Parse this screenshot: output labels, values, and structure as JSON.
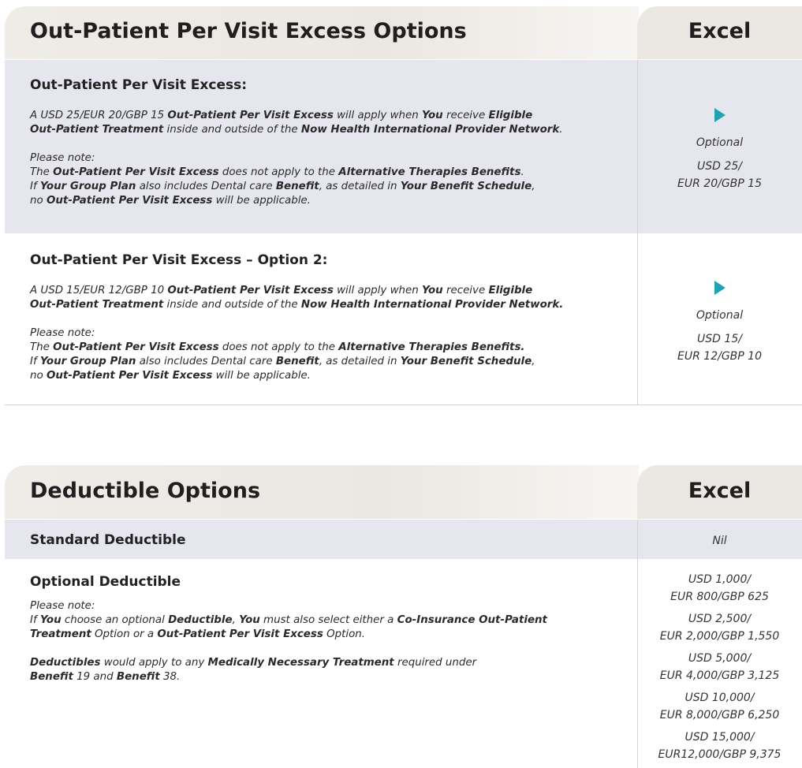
{
  "section1": {
    "title": "Out-Patient Per Visit Excess Options",
    "plan": "Excel",
    "row1": {
      "heading": "Out-Patient Per Visit Excess:",
      "p1": [
        {
          "t": "A USD 25/EUR 20/GBP 15 "
        },
        {
          "t": "Out-Patient Per Visit Excess",
          "b": true
        },
        {
          "t": " will apply when "
        },
        {
          "t": "You",
          "b": true
        },
        {
          "t": " receive "
        },
        {
          "t": "Eligible",
          "b": true
        },
        {
          "br": true
        },
        {
          "t": "Out-Patient Treatment",
          "b": true
        },
        {
          "t": " inside and outside of the "
        },
        {
          "t": "Now Health International Provider Network",
          "b": true
        },
        {
          "t": "."
        }
      ],
      "p2": [
        {
          "t": "Please note:"
        },
        {
          "br": true
        },
        {
          "t": "The "
        },
        {
          "t": "Out-Patient Per Visit Excess",
          "b": true
        },
        {
          "t": " does not apply to the "
        },
        {
          "t": "Alternative Therapies Benefits",
          "b": true
        },
        {
          "t": "."
        },
        {
          "br": true
        },
        {
          "t": "If "
        },
        {
          "t": "Your Group Plan",
          "b": true
        },
        {
          "t": " also includes Dental care "
        },
        {
          "t": "Benefit",
          "b": true
        },
        {
          "t": ", as detailed in "
        },
        {
          "t": "Your Benefit Schedule",
          "b": true
        },
        {
          "t": ","
        },
        {
          "br": true
        },
        {
          "t": "no "
        },
        {
          "t": "Out-Patient Per Visit Excess",
          "b": true
        },
        {
          "t": " will be applicable."
        }
      ],
      "status": "Optional",
      "amount_line1": "USD 25/",
      "amount_line2": "EUR 20/GBP 15"
    },
    "row2": {
      "heading": "Out-Patient Per Visit Excess – Option 2:",
      "p1": [
        {
          "t": "A USD 15/EUR 12/GBP 10 "
        },
        {
          "t": "Out-Patient Per Visit Excess",
          "b": true
        },
        {
          "t": " will apply when "
        },
        {
          "t": "You",
          "b": true
        },
        {
          "t": " receive "
        },
        {
          "t": "Eligible",
          "b": true
        },
        {
          "br": true
        },
        {
          "t": "Out-Patient Treatment",
          "b": true
        },
        {
          "t": " inside and outside of the "
        },
        {
          "t": "Now Health International Provider Network.",
          "b": true
        }
      ],
      "p2": [
        {
          "t": "Please note:"
        },
        {
          "br": true
        },
        {
          "t": "The "
        },
        {
          "t": "Out-Patient Per Visit Excess",
          "b": true
        },
        {
          "t": " does not apply to the "
        },
        {
          "t": "Alternative Therapies Benefits.",
          "b": true
        },
        {
          "br": true
        },
        {
          "t": "If "
        },
        {
          "t": "Your Group Plan",
          "b": true
        },
        {
          "t": " also includes Dental care "
        },
        {
          "t": "Benefit",
          "b": true
        },
        {
          "t": ", as detailed in "
        },
        {
          "t": "Your Benefit Schedule",
          "b": true
        },
        {
          "t": ","
        },
        {
          "br": true
        },
        {
          "t": "no "
        },
        {
          "t": "Out-Patient Per Visit Excess",
          "b": true
        },
        {
          "t": " will be applicable."
        }
      ],
      "status": "Optional",
      "amount_line1": "USD 15/",
      "amount_line2": "EUR 12/GBP 10"
    }
  },
  "section2": {
    "title": "Deductible Options",
    "plan": "Excel",
    "standard": {
      "label": "Standard Deductible",
      "value": "Nil"
    },
    "optional": {
      "label": "Optional Deductible",
      "p1": [
        {
          "t": "Please note:"
        },
        {
          "br": true
        },
        {
          "t": "If "
        },
        {
          "t": "You",
          "b": true
        },
        {
          "t": " choose an optional "
        },
        {
          "t": "Deductible",
          "b": true
        },
        {
          "t": ", "
        },
        {
          "t": "You",
          "b": true
        },
        {
          "t": " must also select either a "
        },
        {
          "t": "Co-Insurance Out-Patient",
          "b": true
        },
        {
          "br": true
        },
        {
          "t": "Treatment",
          "b": true
        },
        {
          "t": " Option or a "
        },
        {
          "t": "Out-Patient Per Visit Excess",
          "b": true
        },
        {
          "t": " Option."
        }
      ],
      "p2": [
        {
          "t": "Deductibles",
          "b": true
        },
        {
          "t": " would apply to any "
        },
        {
          "t": "Medically Necessary Treatment",
          "b": true
        },
        {
          "t": " required under"
        },
        {
          "br": true
        },
        {
          "t": "Benefit",
          "b": true
        },
        {
          "t": " 19 and "
        },
        {
          "t": "Benefit",
          "b": true
        },
        {
          "t": " 38."
        }
      ],
      "options": [
        {
          "line1": "USD 1,000/",
          "line2": "EUR 800/GBP 625"
        },
        {
          "line1": "USD 2,500/",
          "line2": "EUR 2,000/GBP 1,550"
        },
        {
          "line1": "USD 5,000/",
          "line2": "EUR 4,000/GBP 3,125"
        },
        {
          "line1": "USD 10,000/",
          "line2": "EUR 8,000/GBP 6,250"
        },
        {
          "line1": "USD 15,000/",
          "line2": "EUR12,000/GBP 9,375"
        }
      ]
    }
  },
  "colors": {
    "band": "#e6e6ef",
    "header": "#ebe7e2",
    "arrow": "#1fa3b1"
  }
}
